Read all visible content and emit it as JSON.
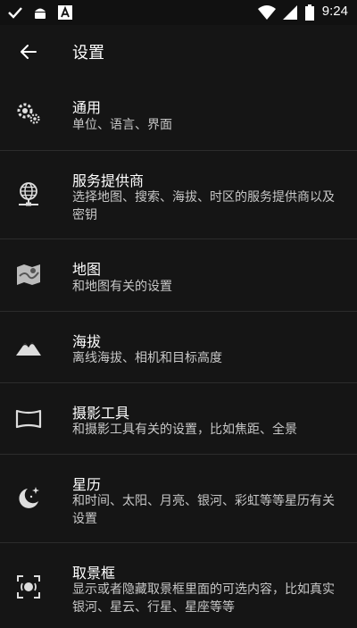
{
  "status_bar": {
    "time": "9:24",
    "icons": [
      "check-icon",
      "android-icon",
      "font-a-icon",
      "wifi-icon",
      "signal-icon",
      "battery-icon"
    ]
  },
  "app_bar": {
    "title": "设置",
    "back_icon": "arrow-back-icon"
  },
  "settings": [
    {
      "title": "通用",
      "subtitle": "单位、语言、界面",
      "icon": "gears-icon"
    },
    {
      "title": "服务提供商",
      "subtitle": "选择地图、搜索、海拔、时区的服务提供商以及密钥",
      "icon": "globe-network-icon"
    },
    {
      "title": "地图",
      "subtitle": "和地图有关的设置",
      "icon": "map-icon"
    },
    {
      "title": "海拔",
      "subtitle": "离线海拔、相机和目标高度",
      "icon": "mountain-icon"
    },
    {
      "title": "摄影工具",
      "subtitle": "和摄影工具有关的设置，比如焦距、全景",
      "icon": "panorama-icon"
    },
    {
      "title": "星历",
      "subtitle": "和时间、太阳、月亮、银河、彩虹等等星历有关设置",
      "icon": "moon-stars-icon"
    },
    {
      "title": "取景框",
      "subtitle": "显示或者隐藏取景框里面的可选内容，比如真实银河、星云、行星、星座等等",
      "icon": "viewfinder-icon"
    }
  ]
}
